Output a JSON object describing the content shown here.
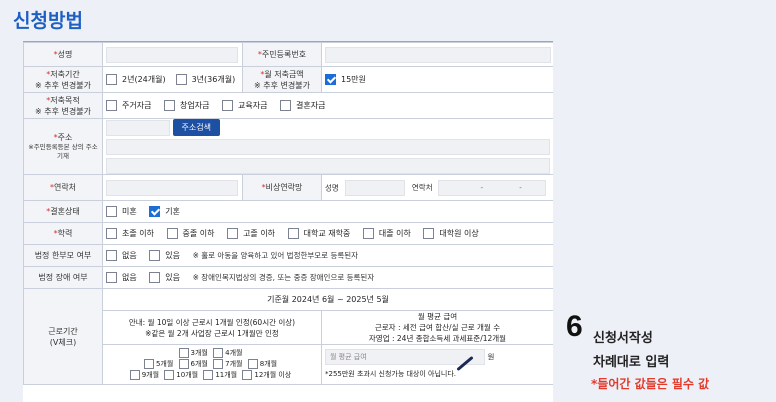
{
  "page": {
    "title": "신청방법"
  },
  "form": {
    "name": {
      "label": "성명"
    },
    "rrn": {
      "label": "주민등록번호"
    },
    "savings_period": {
      "label": "저축기간",
      "note": "※ 추후 변경불가",
      "options": [
        {
          "label": "2년(24개월)",
          "checked": false
        },
        {
          "label": "3년(36개월)",
          "checked": false
        }
      ]
    },
    "monthly_amount": {
      "label": "월 저축금액",
      "note": "※ 추후 변경불가",
      "options": [
        {
          "label": "15만원",
          "checked": true
        }
      ]
    },
    "savings_purpose": {
      "label": "저축목적",
      "note": "※ 추후 변경불가",
      "options": [
        {
          "label": "주거자금",
          "checked": false
        },
        {
          "label": "창업자금",
          "checked": false
        },
        {
          "label": "교육자금",
          "checked": false
        },
        {
          "label": "결혼자금",
          "checked": false
        }
      ]
    },
    "address": {
      "label": "주소",
      "note": "※주민등록등본 상의 주소 기재",
      "search_button": "주소검색"
    },
    "contact": {
      "label": "연락처"
    },
    "emergency_contact": {
      "label": "비상연락망",
      "name_label": "성명",
      "phone_label": "연락처",
      "dash1": "-",
      "dash2": "-"
    },
    "marital": {
      "label": "결혼상태",
      "options": [
        {
          "label": "미혼",
          "checked": false
        },
        {
          "label": "기혼",
          "checked": true
        }
      ]
    },
    "education": {
      "label": "학력",
      "options": [
        {
          "label": "초졸 이하",
          "checked": false
        },
        {
          "label": "중졸 이하",
          "checked": false
        },
        {
          "label": "고졸 이하",
          "checked": false
        },
        {
          "label": "대학교 재학중",
          "checked": false
        },
        {
          "label": "대졸 이하",
          "checked": false
        },
        {
          "label": "대학원 이상",
          "checked": false
        }
      ]
    },
    "single_parent": {
      "label": "법정 한부모 여부",
      "options": [
        {
          "label": "없음",
          "checked": false
        },
        {
          "label": "있음",
          "checked": false
        }
      ],
      "note": "※ 홀로 아동을 양육하고 있어 법정한부모로 등록된자"
    },
    "disability": {
      "label": "법정 장애 여부",
      "options": [
        {
          "label": "없음",
          "checked": false
        },
        {
          "label": "있음",
          "checked": false
        }
      ],
      "note": "※ 장애인복지법상의 경증, 또는 중증 장애인으로 등록된자"
    },
    "work_period": {
      "label": "근로기간",
      "sub_label": "(V체크)",
      "range": "기준월 2024년 6월 ~ 2025년 5월",
      "guide_line1": "안내: 월 10일 이상 근로시 1개월 인정(60시간 이상)",
      "guide_line2": "※같은 월 2개 사업장 근로시 1개월만 인정",
      "month_rows": [
        [
          "3개월",
          "4개월"
        ],
        [
          "5개월",
          "6개월",
          "7개월",
          "8개월"
        ],
        [
          "9개월",
          "10개월",
          "11개월",
          "12개월 이상"
        ]
      ],
      "avg_title": "월 평균 급여",
      "avg_line1": "근로자 : 세전 급여 합산/실 근로 개월 수",
      "avg_line2": "자영업 : 24년 종합소득세 과세표준/12개월",
      "avg_placeholder": "월 평균 급여",
      "avg_unit": "원",
      "avg_note": "*255만원 초과시 신청가능 대상이 아닙니다."
    }
  },
  "guide": {
    "step": "6",
    "line1": "신청서작성",
    "line2": "차례대로 입력",
    "line3": "*들어간 값들은 필수 값"
  }
}
